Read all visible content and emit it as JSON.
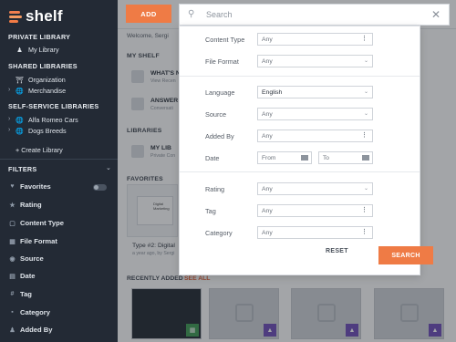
{
  "app": {
    "logo_text": "shelf"
  },
  "sidebar": {
    "private_title": "PRIVATE LIBRARY",
    "private_items": [
      {
        "label": "My Library",
        "icon": "person-icon"
      }
    ],
    "shared_title": "SHARED LIBRARIES",
    "shared_items": [
      {
        "label": "Organization",
        "icon": "building-icon"
      },
      {
        "label": "Merchandise",
        "icon": "globe-icon"
      }
    ],
    "selfservice_title": "SELF-SERVICE LIBRARIES",
    "selfservice_items": [
      {
        "label": "Alfa Romeo Cars",
        "icon": "globe-icon"
      },
      {
        "label": "Dogs Breeds",
        "icon": "globe-icon"
      }
    ],
    "create_label": "+ Create Library",
    "filters_title": "FILTERS",
    "filters": [
      {
        "label": "Favorites",
        "icon": "heart-icon"
      },
      {
        "label": "Rating",
        "icon": "star-icon"
      },
      {
        "label": "Content Type",
        "icon": "file-icon"
      },
      {
        "label": "File Format",
        "icon": "format-icon"
      },
      {
        "label": "Source",
        "icon": "source-icon"
      },
      {
        "label": "Date",
        "icon": "calendar-icon"
      },
      {
        "label": "Tag",
        "icon": "hash-icon"
      },
      {
        "label": "Category",
        "icon": "category-icon"
      },
      {
        "label": "Added By",
        "icon": "person-icon"
      }
    ]
  },
  "toolbar": {
    "add_label": "ADD"
  },
  "search": {
    "placeholder": "Search"
  },
  "main": {
    "welcome": "Welcome, Sergi",
    "myshelf_title": "MY SHELF",
    "myshelf_items": [
      {
        "title": "WHAT'S N",
        "sub": "View Recen"
      },
      {
        "title": "ANSWER",
        "sub": "Conversati"
      }
    ],
    "libraries_title": "LIBRARIES",
    "library_item": {
      "title": "MY LIB",
      "sub": "Private Con"
    },
    "favorites_title": "FAVORITES",
    "favorite_card_label": "Digital Marketing",
    "favorite_title": "Type #2: Digital",
    "favorite_sub": "a year ago, by Sergi",
    "recent_title": "RECENTLY ADDED",
    "see_all": "SEE ALL"
  },
  "filter_panel": {
    "fields": [
      {
        "label": "Content Type",
        "value": "Any"
      },
      {
        "label": "File Format",
        "value": "Any"
      },
      {
        "label": "Language",
        "value": "English"
      },
      {
        "label": "Source",
        "value": "Any"
      },
      {
        "label": "Added By",
        "value": "Any"
      },
      {
        "label": "Date",
        "from": "From",
        "to": "To"
      },
      {
        "label": "Rating",
        "value": "Any"
      },
      {
        "label": "Tag",
        "value": "Any"
      },
      {
        "label": "Category",
        "value": "Any"
      }
    ],
    "reset_label": "RESET",
    "search_label": "SEARCH"
  },
  "colors": {
    "accent": "#ef7b45",
    "sidebar_bg": "#232a35",
    "badge_purple": "#6d4ab8",
    "badge_green": "#3d9a51"
  }
}
